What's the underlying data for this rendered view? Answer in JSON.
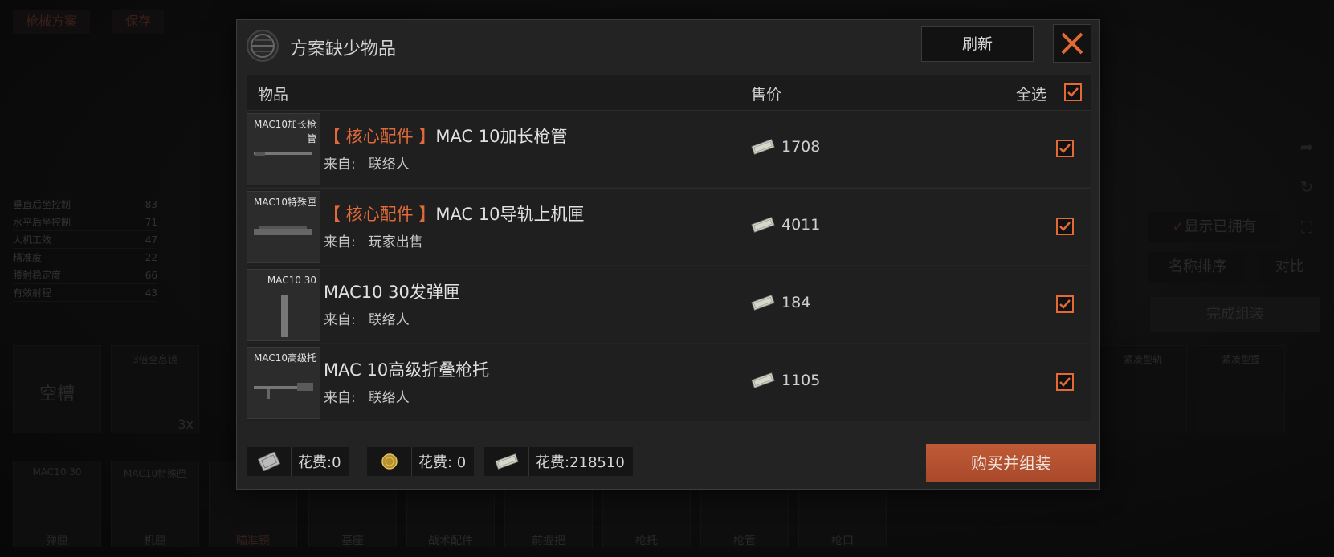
{
  "background": {
    "top_buttons": [
      "枪械方案",
      "保存"
    ],
    "stats": [
      {
        "label": "垂直后坐控制",
        "value": "83"
      },
      {
        "label": "水平后坐控制",
        "value": "71"
      },
      {
        "label": "人机工效",
        "value": "47"
      },
      {
        "label": "精准度",
        "value": "22"
      },
      {
        "label": "腰射稳定度",
        "value": "66"
      },
      {
        "label": "有效射程",
        "value": "43"
      }
    ],
    "slots_row1": [
      {
        "label": "空槽"
      },
      {
        "label": "3倍全息镜",
        "badge": "3x"
      }
    ],
    "slots_row2": [
      {
        "top": "MAC10 30",
        "bottom": "弹匣"
      },
      {
        "top": "MAC10特殊匣",
        "bottom": "机匣"
      },
      {
        "top": "",
        "bottom": "瞄准镜"
      },
      {
        "top": "",
        "bottom": "基座"
      },
      {
        "top": "",
        "bottom": "战术配件"
      },
      {
        "top": "",
        "bottom": "前握把"
      },
      {
        "top": "",
        "bottom": "枪托"
      },
      {
        "top": "",
        "bottom": "枪管"
      },
      {
        "top": "",
        "bottom": "枪口"
      }
    ],
    "right_slots": [
      "紧凑型轨",
      "紧凑型握"
    ],
    "side_buttons": {
      "show_owned": "显示已拥有",
      "sort_name": "名称排序",
      "compare": "对比",
      "finish": "完成组装"
    }
  },
  "modal": {
    "title": "方案缺少物品",
    "refresh_label": "刷新",
    "columns": {
      "item": "物品",
      "price": "售价",
      "select_all": "全选"
    },
    "select_all_checked": true,
    "source_prefix": "来自:",
    "items": [
      {
        "thumb_label": "MAC10加长枪管",
        "tag": "【 核心配件 】",
        "name": "MAC 10加长枪管",
        "source": "联络人",
        "price": "1708",
        "checked": true
      },
      {
        "thumb_label": "MAC10特殊匣",
        "tag": "【 核心配件 】",
        "name": "MAC 10导轨上机匣",
        "source": "玩家出售",
        "price": "4011",
        "checked": true
      },
      {
        "thumb_label": "MAC10 30",
        "tag": "",
        "name": "MAC10 30发弹匣",
        "source": "联络人",
        "price": "184",
        "checked": true
      },
      {
        "thumb_label": "MAC10高级托",
        "tag": "",
        "name": "MAC 10高级折叠枪托",
        "source": "联络人",
        "price": "1105",
        "checked": true
      }
    ],
    "costs": [
      {
        "icon": "voucher-icon",
        "text": "花费:0"
      },
      {
        "icon": "coin-icon",
        "text": "花费: 0"
      },
      {
        "icon": "cash-icon",
        "text": "花费:218510"
      }
    ],
    "buy_label": "购买并组装"
  },
  "colors": {
    "accent": "#e36a35",
    "buy_button": "#b8522f",
    "panel": "#232323"
  }
}
